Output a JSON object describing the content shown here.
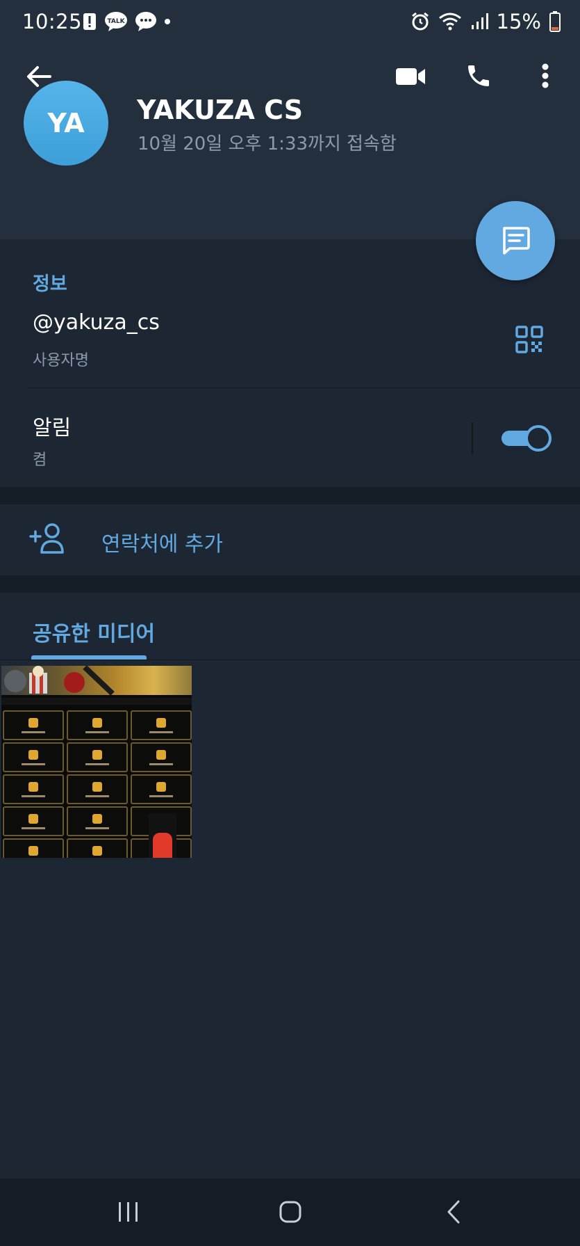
{
  "status_bar": {
    "time": "10:25",
    "talk_badge": "TALK",
    "battery_percent": "15%"
  },
  "header": {
    "back_icon": "arrow-left-icon",
    "actions": [
      "video-call-icon",
      "phone-icon",
      "more-vertical-icon"
    ]
  },
  "profile": {
    "avatar_initials": "YA",
    "avatar_color": "#4aa9e3",
    "name": "YAKUZA CS",
    "last_seen": "10월 20일 오후 1:33까지 접속함"
  },
  "fab": {
    "icon": "message-icon"
  },
  "info": {
    "heading": "정보",
    "username_value": "@yakuza_cs",
    "username_label": "사용자명",
    "qr_icon": "qr-code-icon",
    "notifications_label": "알림",
    "notifications_state": "켬",
    "notifications_on": true
  },
  "add_contact": {
    "icon": "add-user-icon",
    "label": "연락처에 추가"
  },
  "media": {
    "tab_label": "공유한 미디어",
    "items": [
      "shared-image-1"
    ]
  },
  "nav": {
    "buttons": [
      "recent-apps-icon",
      "home-icon",
      "back-icon"
    ]
  },
  "colors": {
    "accent": "#62a9e2",
    "background": "#1d2733",
    "header": "#232f3d",
    "secondary_text": "#8c9aab"
  }
}
